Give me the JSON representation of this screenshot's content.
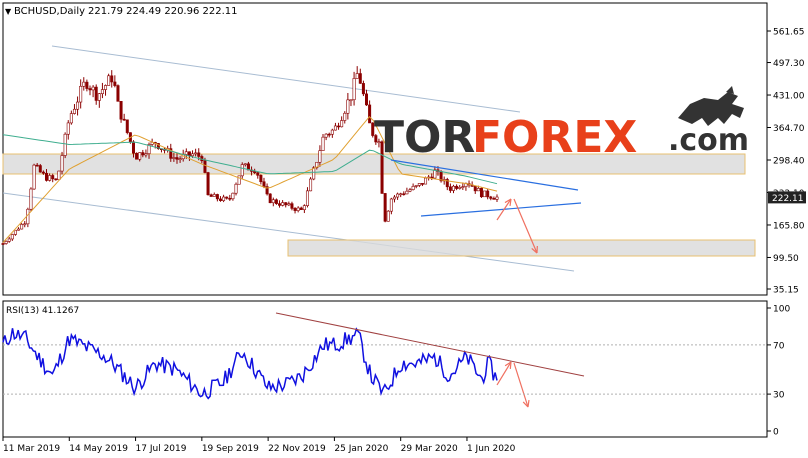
{
  "header": {
    "symbol": "BCHUSD,Daily",
    "ohlc": "221.79 224.49 220.96 222.11"
  },
  "logo": {
    "part1": "TOR",
    "part2": "FOREX",
    "part3": ".com"
  },
  "colors": {
    "bull_candle": "#8b0000",
    "bear_candle": "#8b0000",
    "ma_fast": "#e0a030",
    "ma_slow": "#3fae8f",
    "channel": "#a8bcd2",
    "triangle": "#2a6fe0",
    "zone_fill": "#d9d9d9",
    "zone_border": "#e8c070",
    "forecast_arrow": "#f07060",
    "rsi_line": "#1010e0",
    "rsi_trend": "#a04040",
    "logo_dark": "#333333",
    "logo_red": "#e8401a",
    "price_tag": "#222222"
  },
  "chart_data": [
    {
      "type": "candlestick",
      "title": "BCHUSD,Daily",
      "ylim": [
        35.15,
        590
      ],
      "y_ticks": [
        561.65,
        497.3,
        431.0,
        364.7,
        298.4,
        232.1,
        165.8,
        99.5,
        35.15
      ],
      "y_tick_labels": [
        "561.65",
        "497.30",
        "431.00",
        "364.70",
        "298.40",
        "232.10",
        "165.80",
        "99.50",
        "35.15"
      ],
      "last_price_label": "222.11",
      "last_price": 222.11,
      "x_tick_labels": [
        "11 Mar 2019",
        "14 May 2019",
        "17 Jul 2019",
        "19 Sep 2019",
        "22 Nov 2019",
        "25 Jan 2020",
        "29 Mar 2020",
        "1 Jun 2020"
      ],
      "series": [
        {
          "name": "close",
          "anchors": [
            [
              "11 Mar 2019",
              128
            ],
            [
              "2 Apr 2019",
              175
            ],
            [
              "10 Apr 2019",
              285
            ],
            [
              "20 Apr 2019",
              265
            ],
            [
              "2 May 2019",
              255
            ],
            [
              "14 May 2019",
              385
            ],
            [
              "30 May 2019",
              460
            ],
            [
              "10 Jun 2019",
              430
            ],
            [
              "25 Jun 2019",
              470
            ],
            [
              "30 Jun 2019",
              410
            ],
            [
              "17 Jul 2019",
              305
            ],
            [
              "5 Aug 2019",
              335
            ],
            [
              "25 Aug 2019",
              300
            ],
            [
              "10 Sep 2019",
              310
            ],
            [
              "19 Sep 2019",
              305
            ],
            [
              "25 Sep 2019",
              225
            ],
            [
              "15 Oct 2019",
              215
            ],
            [
              "28 Oct 2019",
              285
            ],
            [
              "10 Nov 2019",
              280
            ],
            [
              "22 Nov 2019",
              218
            ],
            [
              "10 Dec 2019",
              205
            ],
            [
              "25 Dec 2019",
              195
            ],
            [
              "15 Jan 2020",
              350
            ],
            [
              "25 Jan 2020",
              360
            ],
            [
              "10 Feb 2020",
              430
            ],
            [
              "17 Feb 2020",
              480
            ],
            [
              "29 Feb 2020",
              360
            ],
            [
              "8 Mar 2020",
              335
            ],
            [
              "13 Mar 2020",
              170
            ],
            [
              "20 Mar 2020",
              220
            ],
            [
              "29 Mar 2020",
              230
            ],
            [
              "15 Apr 2020",
              245
            ],
            [
              "1 May 2020",
              275
            ],
            [
              "15 May 2020",
              240
            ],
            [
              "1 Jun 2020",
              255
            ],
            [
              "15 Jun 2020",
              230
            ],
            [
              "30 Jun 2020",
              222
            ]
          ]
        },
        {
          "name": "MA fast",
          "anchors": [
            [
              "11 Mar 2019",
              130
            ],
            [
              "14 May 2019",
              280
            ],
            [
              "17 Jul 2019",
              350
            ],
            [
              "19 Sep 2019",
              290
            ],
            [
              "22 Nov 2019",
              240
            ],
            [
              "25 Jan 2020",
              300
            ],
            [
              "29 Feb 2020",
              390
            ],
            [
              "29 Mar 2020",
              270
            ],
            [
              "1 Jun 2020",
              250
            ],
            [
              "30 Jun 2020",
              235
            ]
          ]
        },
        {
          "name": "MA slow",
          "anchors": [
            [
              "11 Mar 2019",
              350
            ],
            [
              "14 May 2019",
              330
            ],
            [
              "17 Jul 2019",
              335
            ],
            [
              "19 Sep 2019",
              300
            ],
            [
              "22 Nov 2019",
              270
            ],
            [
              "25 Jan 2020",
              275
            ],
            [
              "29 Feb 2020",
              320
            ],
            [
              "29 Mar 2020",
              290
            ],
            [
              "1 Jun 2020",
              265
            ],
            [
              "30 Jun 2020",
              250
            ]
          ]
        }
      ]
    },
    {
      "type": "line",
      "title": "RSI(13) 41.1267",
      "ylim": [
        0,
        100
      ],
      "y_ticks": [
        100,
        70,
        30,
        0
      ],
      "y_tick_labels": [
        "100",
        "70",
        "30",
        "0"
      ],
      "series": [
        {
          "name": "RSI(13)",
          "anchors": [
            [
              "11 Mar 2019",
              70
            ],
            [
              "20 Mar 2019",
              80
            ],
            [
              "2 Apr 2019",
              75
            ],
            [
              "14 Apr 2019",
              60
            ],
            [
              "28 Apr 2019",
              45
            ],
            [
              "14 May 2019",
              75
            ],
            [
              "30 May 2019",
              68
            ],
            [
              "15 Jun 2019",
              62
            ],
            [
              "25 Jun 2019",
              55
            ],
            [
              "17 Jul 2019",
              35
            ],
            [
              "5 Aug 2019",
              55
            ],
            [
              "25 Aug 2019",
              50
            ],
            [
              "19 Sep 2019",
              30
            ],
            [
              "10 Oct 2019",
              40
            ],
            [
              "28 Oct 2019",
              65
            ],
            [
              "22 Nov 2019",
              35
            ],
            [
              "10 Dec 2019",
              38
            ],
            [
              "25 Dec 2019",
              45
            ],
            [
              "15 Jan 2020",
              70
            ],
            [
              "25 Jan 2020",
              70
            ],
            [
              "17 Feb 2020",
              78
            ],
            [
              "29 Feb 2020",
              45
            ],
            [
              "13 Mar 2020",
              30
            ],
            [
              "29 Mar 2020",
              55
            ],
            [
              "15 Apr 2020",
              55
            ],
            [
              "1 May 2020",
              60
            ],
            [
              "15 May 2020",
              45
            ],
            [
              "1 Jun 2020",
              60
            ],
            [
              "15 Jun 2020",
              42
            ],
            [
              "22 Jun 2020",
              55
            ],
            [
              "30 Jun 2020",
              41.13
            ]
          ]
        }
      ]
    }
  ]
}
